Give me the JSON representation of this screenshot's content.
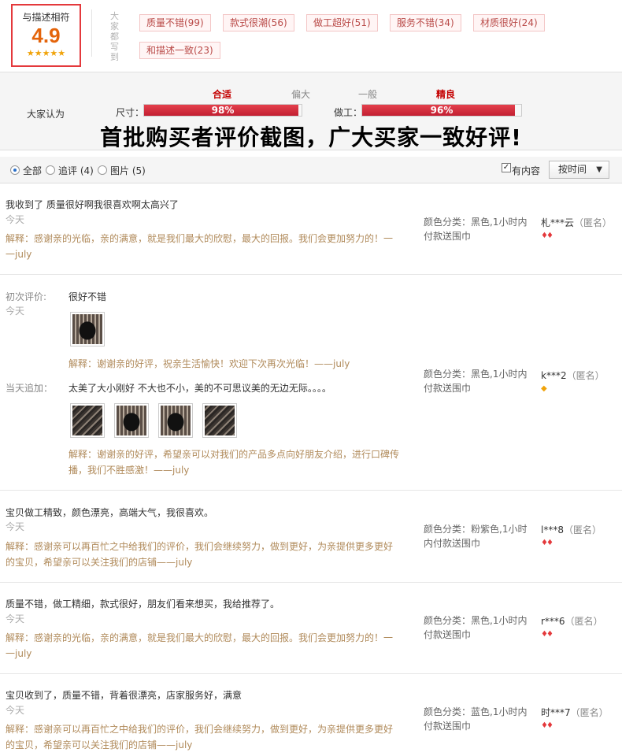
{
  "rating": {
    "label": "与描述相符",
    "score": "4.9",
    "stars": "★★★★★"
  },
  "tags_heading": "大家都写到",
  "tags": [
    "质量不错(99)",
    "款式很潮(56)",
    "做工超好(51)",
    "服务不错(34)",
    "材质很好(24)",
    "和描述一致(23)"
  ],
  "stats": {
    "heading": "大家认为",
    "size": {
      "label": "尺寸：",
      "scale_left": "合适",
      "scale_right": "偏大",
      "value_text": "98%",
      "value": 98
    },
    "work": {
      "label": "做工：",
      "scale_left": "一般",
      "scale_right": "精良",
      "value_text": "96%",
      "value": 96
    }
  },
  "promo": "首批购买者评价截图，广大买家一致好评!",
  "filter": {
    "all": "全部",
    "followup": "追评 (4)",
    "pics": "图片 (5)",
    "has_content": "有内容",
    "sort": "按时间"
  },
  "reviews": [
    {
      "text": "我收到了 质量很好啊我很喜欢啊太高兴了",
      "date": "今天",
      "reply": "解释：感谢亲的光临，亲的满意，就是我们最大的欣慰，最大的回报。我们会更加努力的！一一july",
      "sku": "颜色分类：黑色,1小时内付款送围巾",
      "user": "札***云",
      "anon": "（匿名）"
    },
    {
      "first_label": "初次评价:",
      "date": "今天",
      "text": "很好不错",
      "reply": "解释：谢谢亲的好评，祝亲生活愉快！欢迎下次再次光临！——july",
      "append_label": "当天追加：",
      "append_text": "太美了大小刚好 不大也不小，美的不可思议美的无边无际。。。。",
      "append_reply": "解释：谢谢亲的好评，希望亲可以对我们的产品多点向好朋友介绍，进行口碑传播，我们不胜感激！——july",
      "sku": "颜色分类：黑色,1小时内付款送围巾",
      "user": "k***2",
      "anon": "（匿名）"
    },
    {
      "text": "宝贝做工精致，颜色漂亮，高端大气，我很喜欢。",
      "date": "今天",
      "reply": "解释：感谢亲可以再百忙之中给我们的评价，我们会继续努力，做到更好，为亲提供更多更好的宝贝，希望亲可以关注我们的店铺——july",
      "sku": "颜色分类：粉紫色,1小时内付款送围巾",
      "user": "l***8",
      "anon": "（匿名）"
    },
    {
      "text": "质量不错，做工精细，款式很好，朋友们看来想买，我给推荐了。",
      "date": "今天",
      "reply": "解释：感谢亲的光临，亲的满意，就是我们最大的欣慰，最大的回报。我们会更加努力的！一一july",
      "sku": "颜色分类：黑色,1小时内付款送围巾",
      "user": "r***6",
      "anon": "（匿名）"
    },
    {
      "text": "宝贝收到了，质量不错，背着很漂亮，店家服务好，满意",
      "date": "今天",
      "reply": "解释：感谢亲可以再百忙之中给我们的评价，我们会继续努力，做到更好，为亲提供更多更好的宝贝，希望亲可以关注我们的店铺——july",
      "sku": "颜色分类：蓝色,1小时内付款送围巾",
      "user": "时***7",
      "anon": "（匿名）"
    }
  ]
}
